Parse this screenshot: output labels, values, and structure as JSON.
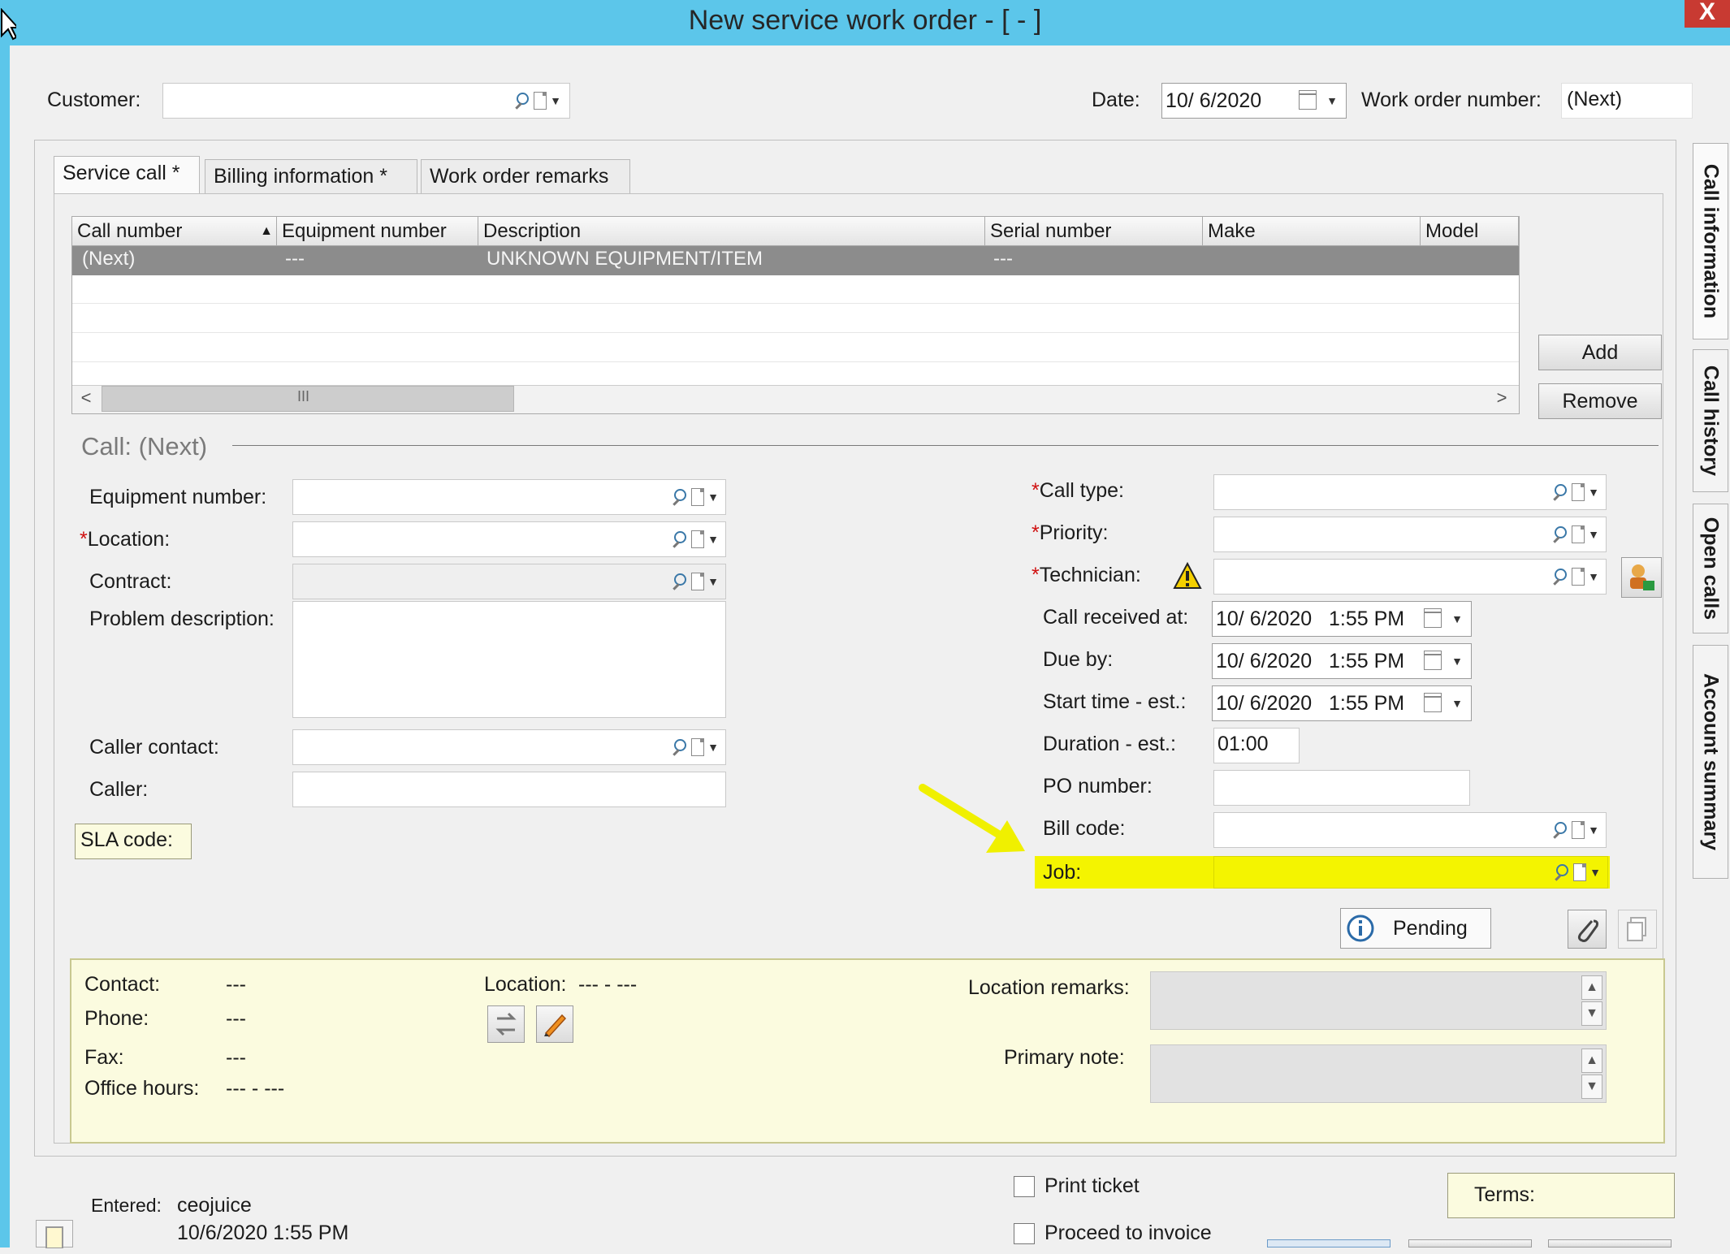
{
  "window": {
    "title": "New service work order - [ - ]",
    "close": "X"
  },
  "header": {
    "customer_label": "Customer:",
    "date_label": "Date:",
    "date_value": "10/ 6/2020",
    "wo_label": "Work order number:",
    "wo_value": "(Next)"
  },
  "tabs": [
    "Service call *",
    "Billing information *",
    "Work order remarks"
  ],
  "side_tabs": [
    "Call information",
    "Call history",
    "Open calls",
    "Account summary"
  ],
  "grid": {
    "columns": [
      "Call number",
      "Equipment number",
      "Description",
      "Serial number",
      "Make",
      "Model"
    ],
    "row": {
      "call_number": "(Next)",
      "equipment_number": "---",
      "description": "UNKNOWN EQUIPMENT/ITEM",
      "serial_number": "---"
    },
    "scroll_thumb": "III",
    "scroll_left": "<",
    "scroll_right": ">"
  },
  "buttons": {
    "add": "Add",
    "remove": "Remove",
    "pending": "Pending"
  },
  "call": {
    "section_label": "Call: (Next)",
    "equipment_label": "Equipment number:",
    "location_label": "Location:",
    "contract_label": "Contract:",
    "problem_label": "Problem description:",
    "caller_contact_label": "Caller contact:",
    "caller_label": "Caller:",
    "sla_label": "SLA code:",
    "call_type_label": "Call type:",
    "priority_label": "Priority:",
    "technician_label": "Technician:",
    "received_label": "Call received at:",
    "received_value": "10/ 6/2020   1:55 PM",
    "due_label": "Due by:",
    "due_value": "10/ 6/2020   1:55 PM",
    "start_label": "Start time - est.:",
    "start_value": "10/ 6/2020   1:55 PM",
    "duration_label": "Duration - est.:",
    "duration_value": "01:00",
    "po_label": "PO number:",
    "bill_label": "Bill code:",
    "job_label": "Job:",
    "required_mark": "*"
  },
  "info": {
    "contact_label": "Contact:",
    "contact_value": "---",
    "phone_label": "Phone:",
    "phone_value": "---",
    "fax_label": "Fax:",
    "fax_value": "---",
    "hours_label": "Office hours:",
    "hours_value": "--- - ---",
    "location_label": "Location:",
    "location_value": "--- - ---",
    "location_remarks_label": "Location remarks:",
    "primary_note_label": "Primary note:"
  },
  "footer": {
    "entered_label": "Entered:",
    "entered_user": "ceojuice",
    "entered_date": "10/6/2020 1:55 PM",
    "print_ticket": "Print ticket",
    "proceed_invoice": "Proceed to invoice",
    "terms_label": "Terms:"
  },
  "colors": {
    "titlebar": "#5cc6ea",
    "highlight": "#f4f400",
    "arrow": "#f0f000",
    "info_panel": "#fbfbdf"
  }
}
